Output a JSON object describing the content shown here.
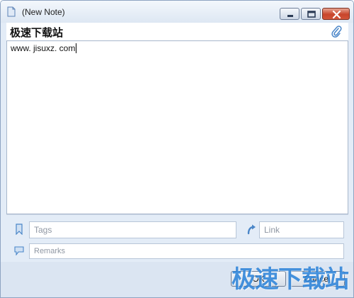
{
  "window": {
    "title": "(New Note)"
  },
  "note": {
    "title": "极速下载站",
    "body_text": "www. jisuxz. com"
  },
  "fields": {
    "tags_placeholder": "Tags",
    "link_placeholder": "Link",
    "remarks_placeholder": "Remarks"
  },
  "buttons": {
    "ok_label": "OK",
    "cancel_label": "Cancel"
  },
  "watermark": {
    "text": "极速下载站"
  },
  "icons": {
    "document": "document-icon",
    "attach": "paperclip-icon",
    "tags": "bookmark-icon",
    "link": "link-arrow-icon",
    "remarks": "comment-icon",
    "minimize": "minimize-icon",
    "maximize": "maximize-icon",
    "close": "close-icon"
  },
  "colors": {
    "watermark": "#1d7ad6",
    "close_button": "#c8452b",
    "accent_icon": "#4a86c8"
  }
}
